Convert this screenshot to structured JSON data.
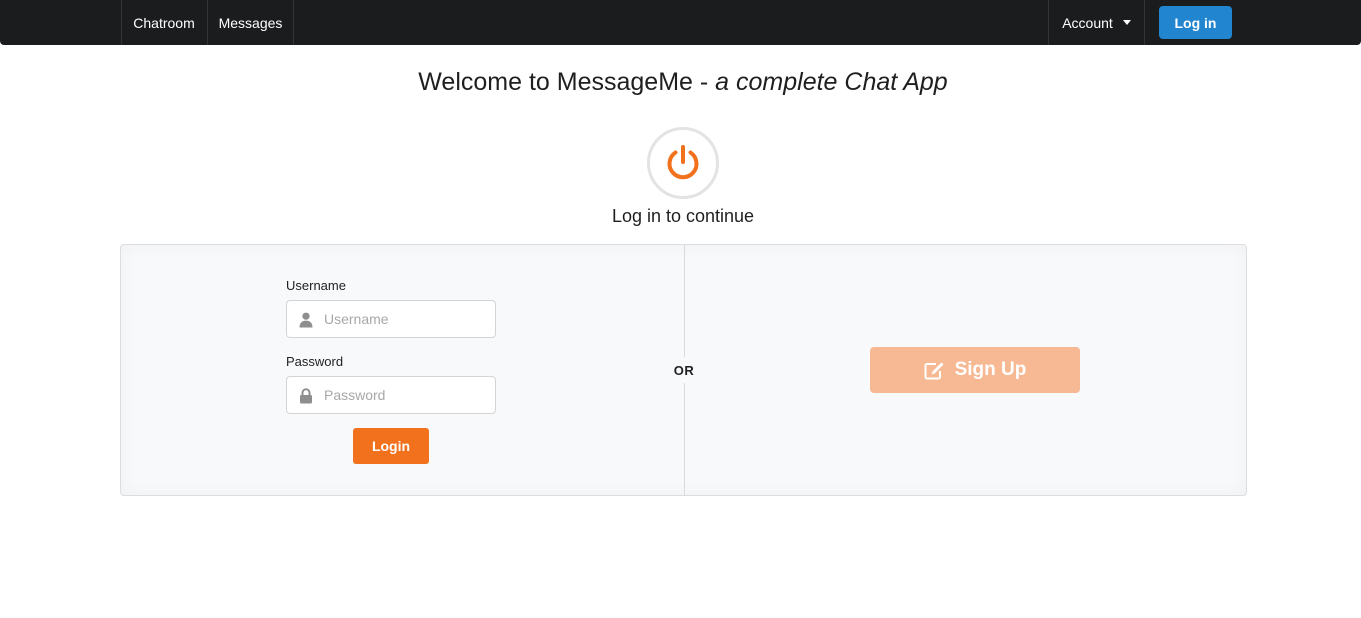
{
  "nav": {
    "chatroom": "Chatroom",
    "messages": "Messages",
    "account": "Account",
    "login": "Log in"
  },
  "header": {
    "welcome_prefix": "Welcome to MessageMe - ",
    "welcome_italic": "a complete Chat App",
    "subtitle": "Log in to continue"
  },
  "form": {
    "username_label": "Username",
    "username_placeholder": "Username",
    "password_label": "Password",
    "password_placeholder": "Password",
    "submit": "Login"
  },
  "divider_text": "OR",
  "signup": {
    "label": "Sign Up"
  },
  "icons": {
    "header": "power-icon",
    "username": "user-icon",
    "password": "lock-icon",
    "signup": "edit-icon",
    "account": "caret-down-icon"
  },
  "colors": {
    "navbar": "#1b1c1d",
    "primary_blue": "#2185d0",
    "orange": "#f2711c",
    "orange_disabled": "#f6b994"
  }
}
